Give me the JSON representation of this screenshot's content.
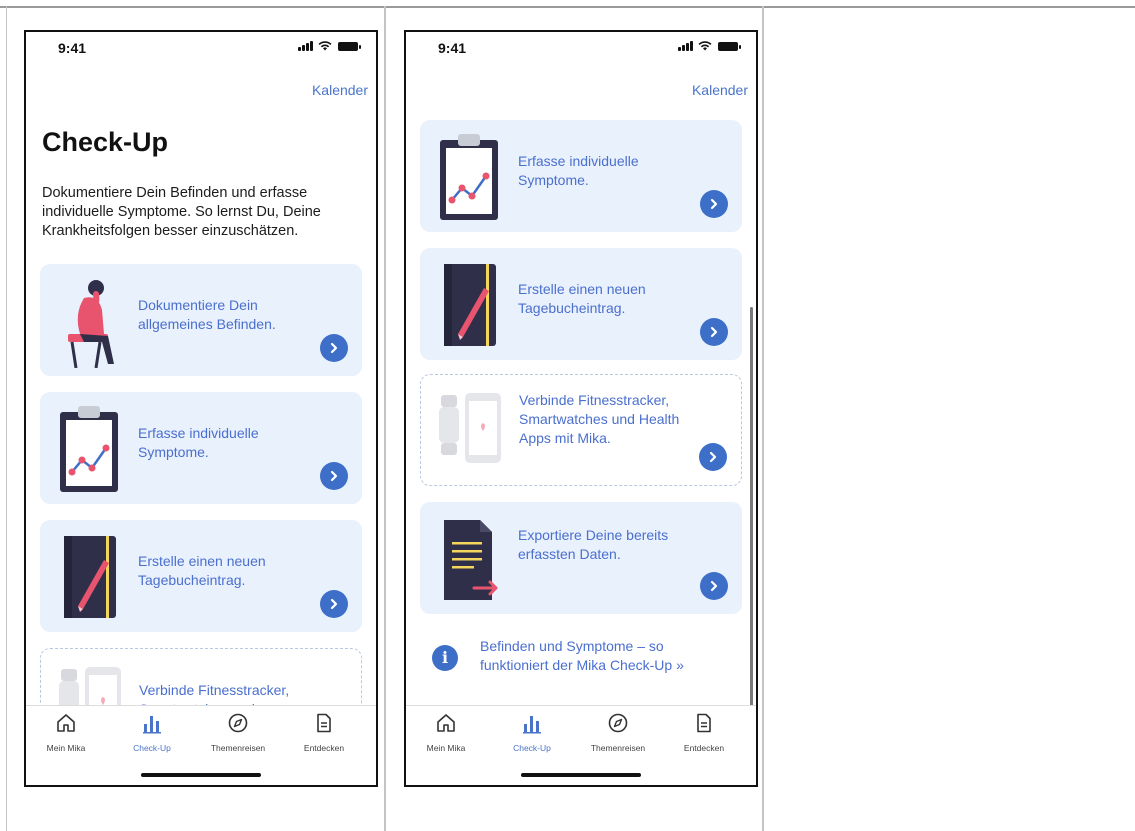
{
  "status_time": "9:41",
  "nav_calendar": "Kalender",
  "screen1": {
    "title": "Check-Up",
    "intro": "Dokumentiere Dein Befinden und erfasse individuelle Symptome. So lernst Du, Deine Krankheitsfolgen besser einzuschätzen.",
    "cards": [
      {
        "label": "Dokumentiere Dein allgemeines Befinden.",
        "icon": "person-sitting-icon"
      },
      {
        "label": "Erfasse individuelle Symptome.",
        "icon": "clipboard-chart-icon"
      },
      {
        "label": "Erstelle einen neuen Tagebucheintrag.",
        "icon": "notebook-icon"
      },
      {
        "label": "Verbinde Fitnesstracker, Smartwatches und",
        "icon": "devices-icon"
      }
    ]
  },
  "screen2": {
    "cards": [
      {
        "label": "Erfasse individuelle Symptome.",
        "icon": "clipboard-chart-icon"
      },
      {
        "label": "Erstelle einen neuen Tagebucheintrag.",
        "icon": "notebook-icon"
      },
      {
        "label": "Verbinde Fitnesstracker, Smartwatches und Health Apps mit Mika.",
        "icon": "devices-icon"
      },
      {
        "label": "Exportiere Deine bereits erfassten Daten.",
        "icon": "document-export-icon"
      }
    ],
    "info_link": "Befinden und Symptome – so funktioniert der Mika Check-Up »"
  },
  "tabs": [
    {
      "label": "Mein Mika",
      "icon": "home-icon",
      "active": false
    },
    {
      "label": "Check-Up",
      "icon": "bar-chart-icon",
      "active": true
    },
    {
      "label": "Themenreisen",
      "icon": "compass-icon",
      "active": false
    },
    {
      "label": "Entdecken",
      "icon": "document-icon",
      "active": false
    }
  ],
  "colors": {
    "accent": "#3d6fc9",
    "link": "#4a6fcf",
    "card_bg": "#e9f1fc",
    "pink": "#e8536e",
    "dark": "#2f2f4a"
  }
}
